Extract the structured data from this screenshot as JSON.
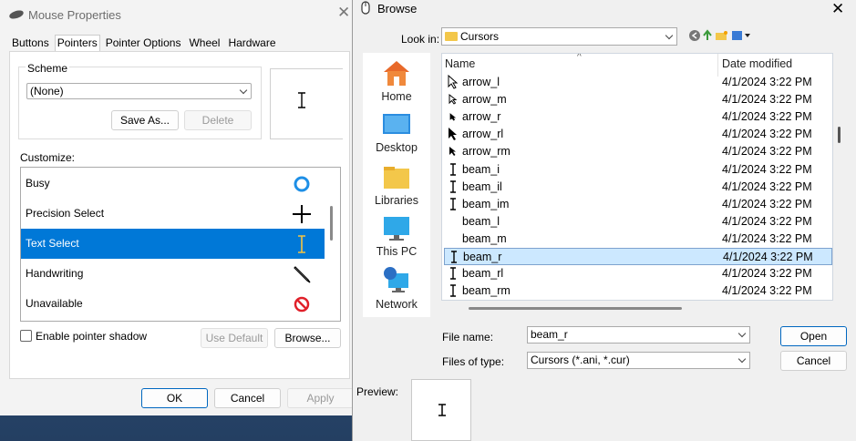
{
  "mouse_properties": {
    "title": "Mouse Properties",
    "tabs": [
      "Buttons",
      "Pointers",
      "Pointer Options",
      "Wheel",
      "Hardware"
    ],
    "active_tab": "Pointers",
    "scheme_label": "Scheme",
    "scheme_value": "(None)",
    "save_as": "Save As...",
    "delete": "Delete",
    "customize_label": "Customize:",
    "items": [
      {
        "label": "Busy",
        "icon": "busy-ring-icon"
      },
      {
        "label": "Precision Select",
        "icon": "crosshair-icon"
      },
      {
        "label": "Text Select",
        "icon": "text-beam-icon",
        "selected": true
      },
      {
        "label": "Handwriting",
        "icon": "pen-icon"
      },
      {
        "label": "Unavailable",
        "icon": "unavailable-icon"
      }
    ],
    "enable_shadow": "Enable pointer shadow",
    "use_default": "Use Default",
    "browse": "Browse...",
    "ok": "OK",
    "cancel": "Cancel",
    "apply": "Apply"
  },
  "browse": {
    "title": "Browse",
    "look_in_label": "Look in:",
    "look_in_value": "Cursors",
    "places": [
      "Home",
      "Desktop",
      "Libraries",
      "This PC",
      "Network"
    ],
    "columns": {
      "name": "Name",
      "date": "Date modified"
    },
    "files": [
      {
        "name": "arrow_l",
        "date": "4/1/2024 3:22 PM",
        "icon": "arrow-large"
      },
      {
        "name": "arrow_m",
        "date": "4/1/2024 3:22 PM",
        "icon": "arrow-medium"
      },
      {
        "name": "arrow_r",
        "date": "4/1/2024 3:22 PM",
        "icon": "arrow-small"
      },
      {
        "name": "arrow_rl",
        "date": "4/1/2024 3:22 PM",
        "icon": "arrow-black-large"
      },
      {
        "name": "arrow_rm",
        "date": "4/1/2024 3:22 PM",
        "icon": "arrow-black-medium"
      },
      {
        "name": "beam_i",
        "date": "4/1/2024 3:22 PM",
        "icon": "beam"
      },
      {
        "name": "beam_il",
        "date": "4/1/2024 3:22 PM",
        "icon": "beam"
      },
      {
        "name": "beam_im",
        "date": "4/1/2024 3:22 PM",
        "icon": "beam"
      },
      {
        "name": "beam_l",
        "date": "4/1/2024 3:22 PM",
        "icon": "none"
      },
      {
        "name": "beam_m",
        "date": "4/1/2024 3:22 PM",
        "icon": "none"
      },
      {
        "name": "beam_r",
        "date": "4/1/2024 3:22 PM",
        "icon": "beam",
        "selected": true
      },
      {
        "name": "beam_rl",
        "date": "4/1/2024 3:22 PM",
        "icon": "beam"
      },
      {
        "name": "beam_rm",
        "date": "4/1/2024 3:22 PM",
        "icon": "beam"
      }
    ],
    "file_name_label": "File name:",
    "file_name_value": "beam_r",
    "files_of_type_label": "Files of type:",
    "files_of_type_value": "Cursors (*.ani, *.cur)",
    "open": "Open",
    "cancel": "Cancel",
    "preview_label": "Preview:"
  },
  "colors": {
    "selection": "#0078d7",
    "file_selection": "#cce8ff",
    "accent": "#0067c0"
  }
}
